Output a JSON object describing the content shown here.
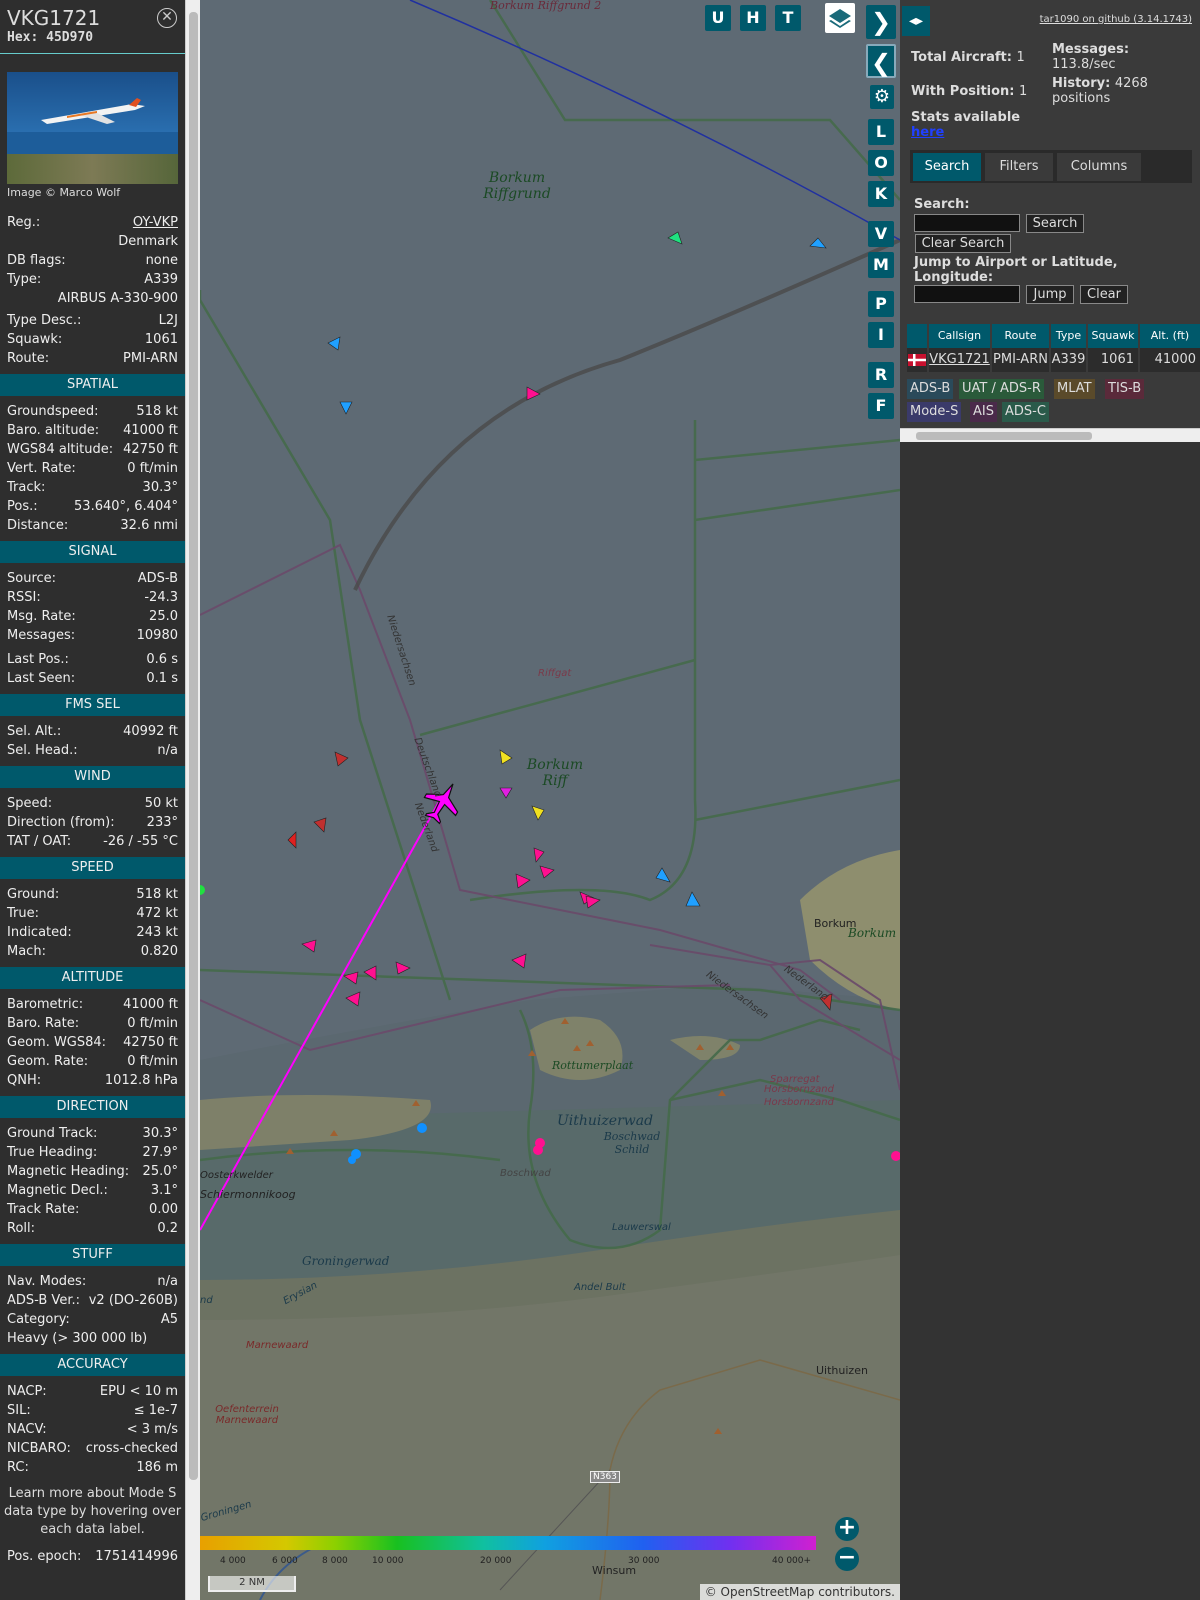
{
  "aircraft": {
    "callsign": "VKG1721",
    "hex": "Hex: 45D970",
    "image_credit": "Image © Marco Wolf",
    "details": [
      {
        "label": "Reg.:",
        "value": "OY-VKP",
        "link": true
      },
      {
        "label": "",
        "value": "Denmark"
      },
      {
        "label": "DB flags:",
        "value": "none"
      },
      {
        "label": "Type:",
        "value": "A339"
      },
      {
        "label": "",
        "value": "AIRBUS A-330-900"
      },
      {
        "label": "Type Desc.:",
        "value": "L2J"
      },
      {
        "label": "Squawk:",
        "value": "1061"
      },
      {
        "label": "Route:",
        "value": "PMI-ARN"
      }
    ],
    "sections": [
      {
        "title": "SPATIAL",
        "rows": [
          [
            "Groundspeed:",
            "518 kt"
          ],
          [
            "Baro. altitude:",
            "41000 ft"
          ],
          [
            "WGS84 altitude:",
            "42750 ft"
          ],
          [
            "Vert. Rate:",
            "0 ft/min"
          ],
          [
            "Track:",
            "30.3°"
          ],
          [
            "Pos.:",
            "53.640°, 6.404°"
          ],
          [
            "Distance:",
            "32.6 nmi"
          ]
        ]
      },
      {
        "title": "SIGNAL",
        "rows": [
          [
            "Source:",
            "ADS-B"
          ],
          [
            "RSSI:",
            "-24.3"
          ],
          [
            "Msg. Rate:",
            "25.0"
          ],
          [
            "Messages:",
            "10980"
          ],
          [
            "Last Pos.:",
            "0.6 s"
          ],
          [
            "Last Seen:",
            "0.1 s"
          ]
        ]
      },
      {
        "title": "FMS SEL",
        "rows": [
          [
            "Sel. Alt.:",
            "40992 ft"
          ],
          [
            "Sel. Head.:",
            "n/a"
          ]
        ]
      },
      {
        "title": "WIND",
        "rows": [
          [
            "Speed:",
            "50 kt"
          ],
          [
            "Direction (from):",
            "233°"
          ],
          [
            "TAT / OAT:",
            "-26 / -55 °C"
          ]
        ]
      },
      {
        "title": "SPEED",
        "rows": [
          [
            "Ground:",
            "518 kt"
          ],
          [
            "True:",
            "472 kt"
          ],
          [
            "Indicated:",
            "243 kt"
          ],
          [
            "Mach:",
            "0.820"
          ]
        ]
      },
      {
        "title": "ALTITUDE",
        "rows": [
          [
            "Barometric:",
            "41000 ft"
          ],
          [
            "Baro. Rate:",
            "0 ft/min"
          ],
          [
            "Geom. WGS84:",
            "42750 ft"
          ],
          [
            "Geom. Rate:",
            "0 ft/min"
          ],
          [
            "QNH:",
            "1012.8 hPa"
          ]
        ]
      },
      {
        "title": "DIRECTION",
        "rows": [
          [
            "Ground Track:",
            "30.3°"
          ],
          [
            "True Heading:",
            "27.9°"
          ],
          [
            "Magnetic Heading:",
            "25.0°"
          ],
          [
            "Magnetic Decl.:",
            "3.1°"
          ],
          [
            "Track Rate:",
            "0.00"
          ],
          [
            "Roll:",
            "0.2"
          ]
        ]
      },
      {
        "title": "STUFF",
        "rows": [
          [
            "Nav. Modes:",
            "n/a"
          ],
          [
            "ADS-B Ver.:",
            "v2 (DO-260B)"
          ],
          [
            "Category:",
            "A5"
          ]
        ]
      },
      {
        "title": "ACCURACY",
        "rows": [
          [
            "NACP:",
            "EPU < 10 m"
          ],
          [
            "SIL:",
            "≤ 1e-7"
          ],
          [
            "NACV:",
            "< 3 m/s"
          ],
          [
            "NICBARO:",
            "cross-checked"
          ],
          [
            "RC:",
            "186 m"
          ]
        ]
      }
    ],
    "stuff_extra": "Heavy (> 300 000 lb)",
    "learn_more": "Learn more about Mode S data type by hovering over each data label.",
    "pos_epoch_label": "Pos. epoch:",
    "pos_epoch_value": "1751414996"
  },
  "map": {
    "buttons_top": [
      "U",
      "H",
      "T"
    ],
    "buttons_side": [
      "L",
      "O",
      "K",
      "V",
      "M",
      "P",
      "I",
      "R",
      "F"
    ],
    "labels": {
      "borkum_riffgrund": "Borkum Riffgrund",
      "borkum_riffgrund2": "Borkum Riffgrund 2",
      "borkum_riff": "Borkum Riff",
      "riffgat": "Riffgat",
      "niedersachsen": "Niedersachsen",
      "deutschland": "Deutschland",
      "nederland": "Nederland",
      "niedersachsen2": "Niedersachsen",
      "nederland2": "Nederland",
      "borkum_town": "Borkum",
      "borkum_island": "Borkum",
      "rottumerplaat": "Rottumerplaat",
      "uithuizerwad": "Uithuizerwad",
      "boschwad_schild": "Boschwad Schild",
      "boschwad": "Boschwad",
      "sparregat": "Sparregat",
      "horsbornzand": "Horsbornzand",
      "horsbornzand2": "Horsbornzand",
      "oosterkwelder": "Oosterkwelder",
      "schiermonnikoog": "Schiermonnikoog",
      "groningerwad": "Groningerwad",
      "lauwerswal": "Lauwerswal",
      "andel_bult": "Andel Bult",
      "erysian": "Erysian",
      "marnewaard": "Marnewaard",
      "oefenterrein": "Oefenterrein Marnewaard",
      "uithuizen": "Uithuizen",
      "winsum": "Winsum",
      "groningen": "Groningen",
      "n363": "N363",
      "nd": "nd"
    },
    "colorbar_ticks": [
      "4 000",
      "6 000",
      "8 000",
      "10 000",
      "20 000",
      "30 000",
      "40 000+"
    ],
    "scale_label": "2 NM",
    "attribution_prefix": "© ",
    "attribution_link": "OpenStreetMap",
    "attribution_suffix": " contributors.",
    "zoom_in": "+",
    "zoom_out": "−"
  },
  "right": {
    "github": "tar1090 on github (3.14.1743)",
    "total_aircraft_label": "Total Aircraft:",
    "total_aircraft": "1",
    "with_position_label": "With Position:",
    "with_position": "1",
    "messages_label": "Messages:",
    "messages": "113.8/sec",
    "history_label": "History:",
    "history": "4268 positions",
    "stats_label": "Stats available",
    "stats_link": "here",
    "tabs": [
      "Search",
      "Filters",
      "Columns"
    ],
    "search_label": "Search:",
    "search_btn": "Search",
    "clear_search_btn": "Clear Search",
    "jump_label": "Jump to Airport or Latitude, Longitude:",
    "jump_btn": "Jump",
    "clear_btn": "Clear",
    "table_headers": [
      "Callsign",
      "Route",
      "Type",
      "Squawk",
      "Alt. (ft)"
    ],
    "table_row": {
      "callsign": "VKG1721",
      "route": "PMI-ARN",
      "type": "A339",
      "squawk": "1061",
      "alt": "41000"
    },
    "badges": [
      "ADS-B",
      "UAT / ADS-R",
      "MLAT",
      "TIS-B",
      "Mode-S",
      "AIS",
      "ADS-C"
    ]
  },
  "colors": {
    "accent": "#00596b",
    "selected_aircraft": "#ff00ff",
    "track_line": "#e020e0"
  }
}
